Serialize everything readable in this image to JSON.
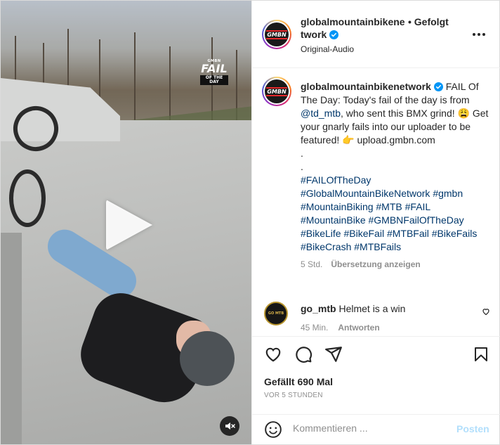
{
  "video": {
    "overlay_badge": {
      "top": "GMBN",
      "main": "FAIL",
      "band": "OF THE DAY"
    },
    "controls": {
      "play_icon": "play-icon",
      "mute_icon": "muted-speaker-icon"
    }
  },
  "header": {
    "username": "globalmountainbikenetwork",
    "follow_status": "• Gefolgt",
    "audio": "Original-Audio",
    "avatar_text": "GMBN"
  },
  "caption": {
    "username": "globalmountainbikenetwork",
    "text_1": "FAIL Of The Day: Today's fail of the day is from ",
    "mention": "@td_mtb",
    "text_2": ", who sent this BMX grind! 😩 Get your gnarly fails into our uploader to be featured! 👉 upload.gmbn.com",
    "dot_1": ".",
    "dot_2": ".",
    "hashtags": "#FAILOfTheDay #GlobalMountainBikeNetwork #gmbn #MountainBiking #MTB #FAIL #MountainBike #GMBNFailOfTheDay #BikeLife #BikeFail #MTBFail #BikeFails #BikeCrash #MTBFails",
    "time": "5 Std.",
    "translate": "Übersetzung anzeigen"
  },
  "comment": {
    "username": "go_mtb",
    "text": "Helmet is a win",
    "avatar_text": "GO MTB",
    "time": "45 Min.",
    "reply": "Antworten"
  },
  "actions": {
    "likes": "Gefällt 690 Mal",
    "date": "VOR 5 STUNDEN"
  },
  "composer": {
    "placeholder": "Kommentieren ...",
    "post_label": "Posten"
  },
  "colors": {
    "verified_blue": "#0095f6",
    "link": "#00376b",
    "post_disabled": "#b2dffc",
    "secondary_text": "#8e8e8e"
  }
}
